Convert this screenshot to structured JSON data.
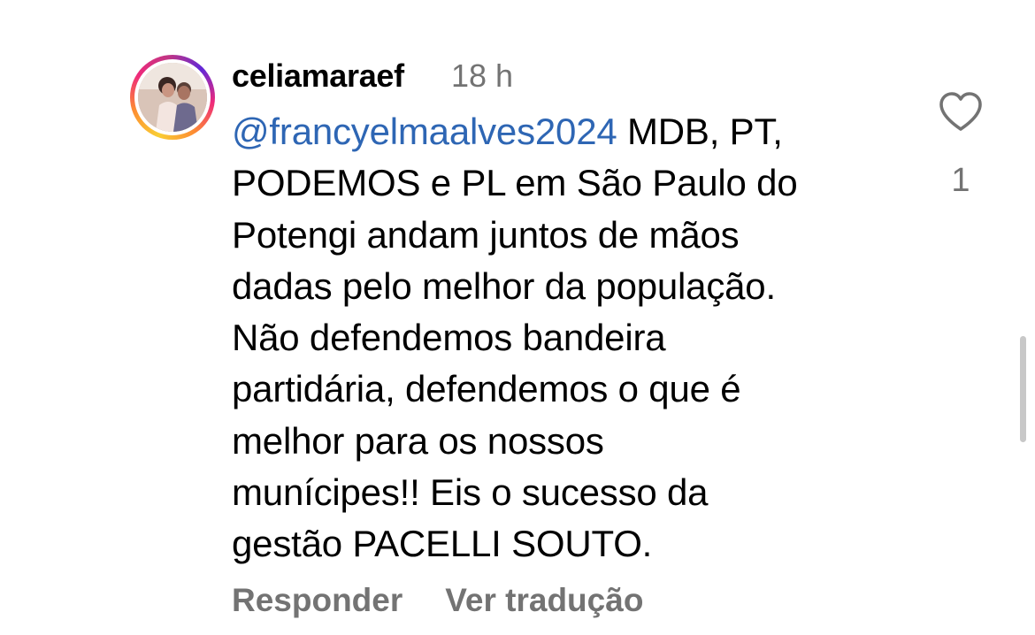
{
  "comment": {
    "username": "celiamaraef",
    "time_ago": "18 h",
    "mention": "@francyelmaalves2024",
    "lines": [
      " MDB, PT,",
      "PODEMOS e PL em São Paulo do",
      "Potengi andam juntos de mãos",
      "dadas pelo melhor da população.",
      "Não defendemos bandeira",
      "partidária, defendemos o que é",
      "melhor para os nossos",
      "munícipes!! Eis o sucesso da",
      "gestão PACELLI SOUTO."
    ],
    "like_count": "1",
    "actions": {
      "reply_label": "Responder",
      "translate_label": "Ver tradução"
    }
  },
  "icons": {
    "like": "heart-outline-icon"
  },
  "colors": {
    "mention": "#2e66b4",
    "secondary_text": "#737373",
    "avatar_ring": [
      "#f9ce34",
      "#ee2a7b",
      "#6228d7"
    ]
  }
}
